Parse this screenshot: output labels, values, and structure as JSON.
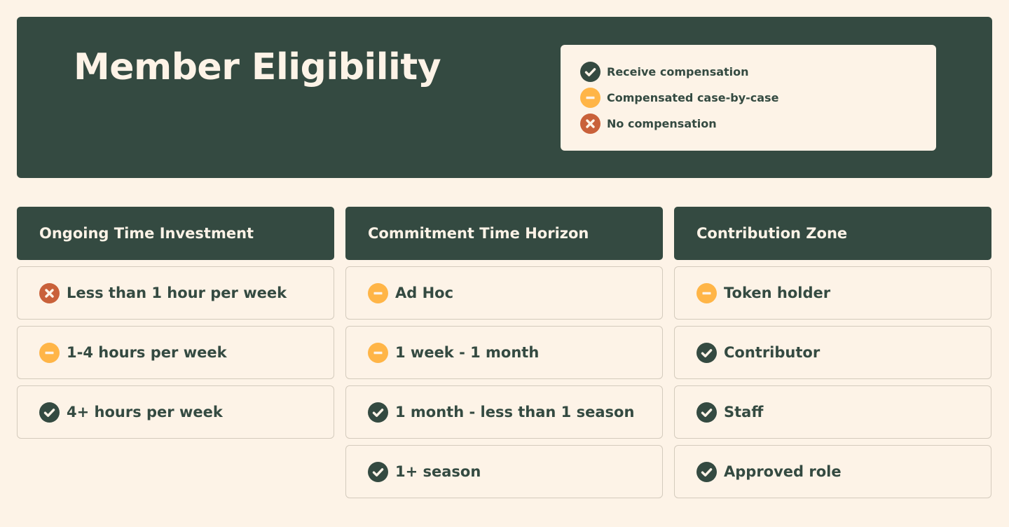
{
  "header": {
    "title": "Member Eligibility"
  },
  "legend": [
    {
      "status": "check",
      "icon": "check-circle-icon",
      "label": "Receive compensation"
    },
    {
      "status": "minus",
      "icon": "minus-circle-icon",
      "label": "Compensated case-by-case"
    },
    {
      "status": "cross",
      "icon": "x-circle-icon",
      "label": "No compensation"
    }
  ],
  "colors": {
    "check": "#344a41",
    "minus": "#ffb547",
    "cross": "#c9613a",
    "background": "#fdf3e7",
    "primary": "#344a41"
  },
  "columns": [
    {
      "title": "Ongoing Time Investment",
      "rows": [
        {
          "status": "cross",
          "label": "Less than 1 hour per week"
        },
        {
          "status": "minus",
          "label": "1-4 hours per week"
        },
        {
          "status": "check",
          "label": "4+ hours per week"
        }
      ]
    },
    {
      "title": "Commitment Time Horizon",
      "rows": [
        {
          "status": "minus",
          "label": "Ad Hoc"
        },
        {
          "status": "minus",
          "label": "1 week - 1 month"
        },
        {
          "status": "check",
          "label": "1 month - less than 1 season"
        },
        {
          "status": "check",
          "label": "1+ season"
        }
      ]
    },
    {
      "title": "Contribution Zone",
      "rows": [
        {
          "status": "minus",
          "label": "Token holder"
        },
        {
          "status": "check",
          "label": "Contributor"
        },
        {
          "status": "check",
          "label": "Staff"
        },
        {
          "status": "check",
          "label": "Approved role"
        }
      ]
    }
  ]
}
